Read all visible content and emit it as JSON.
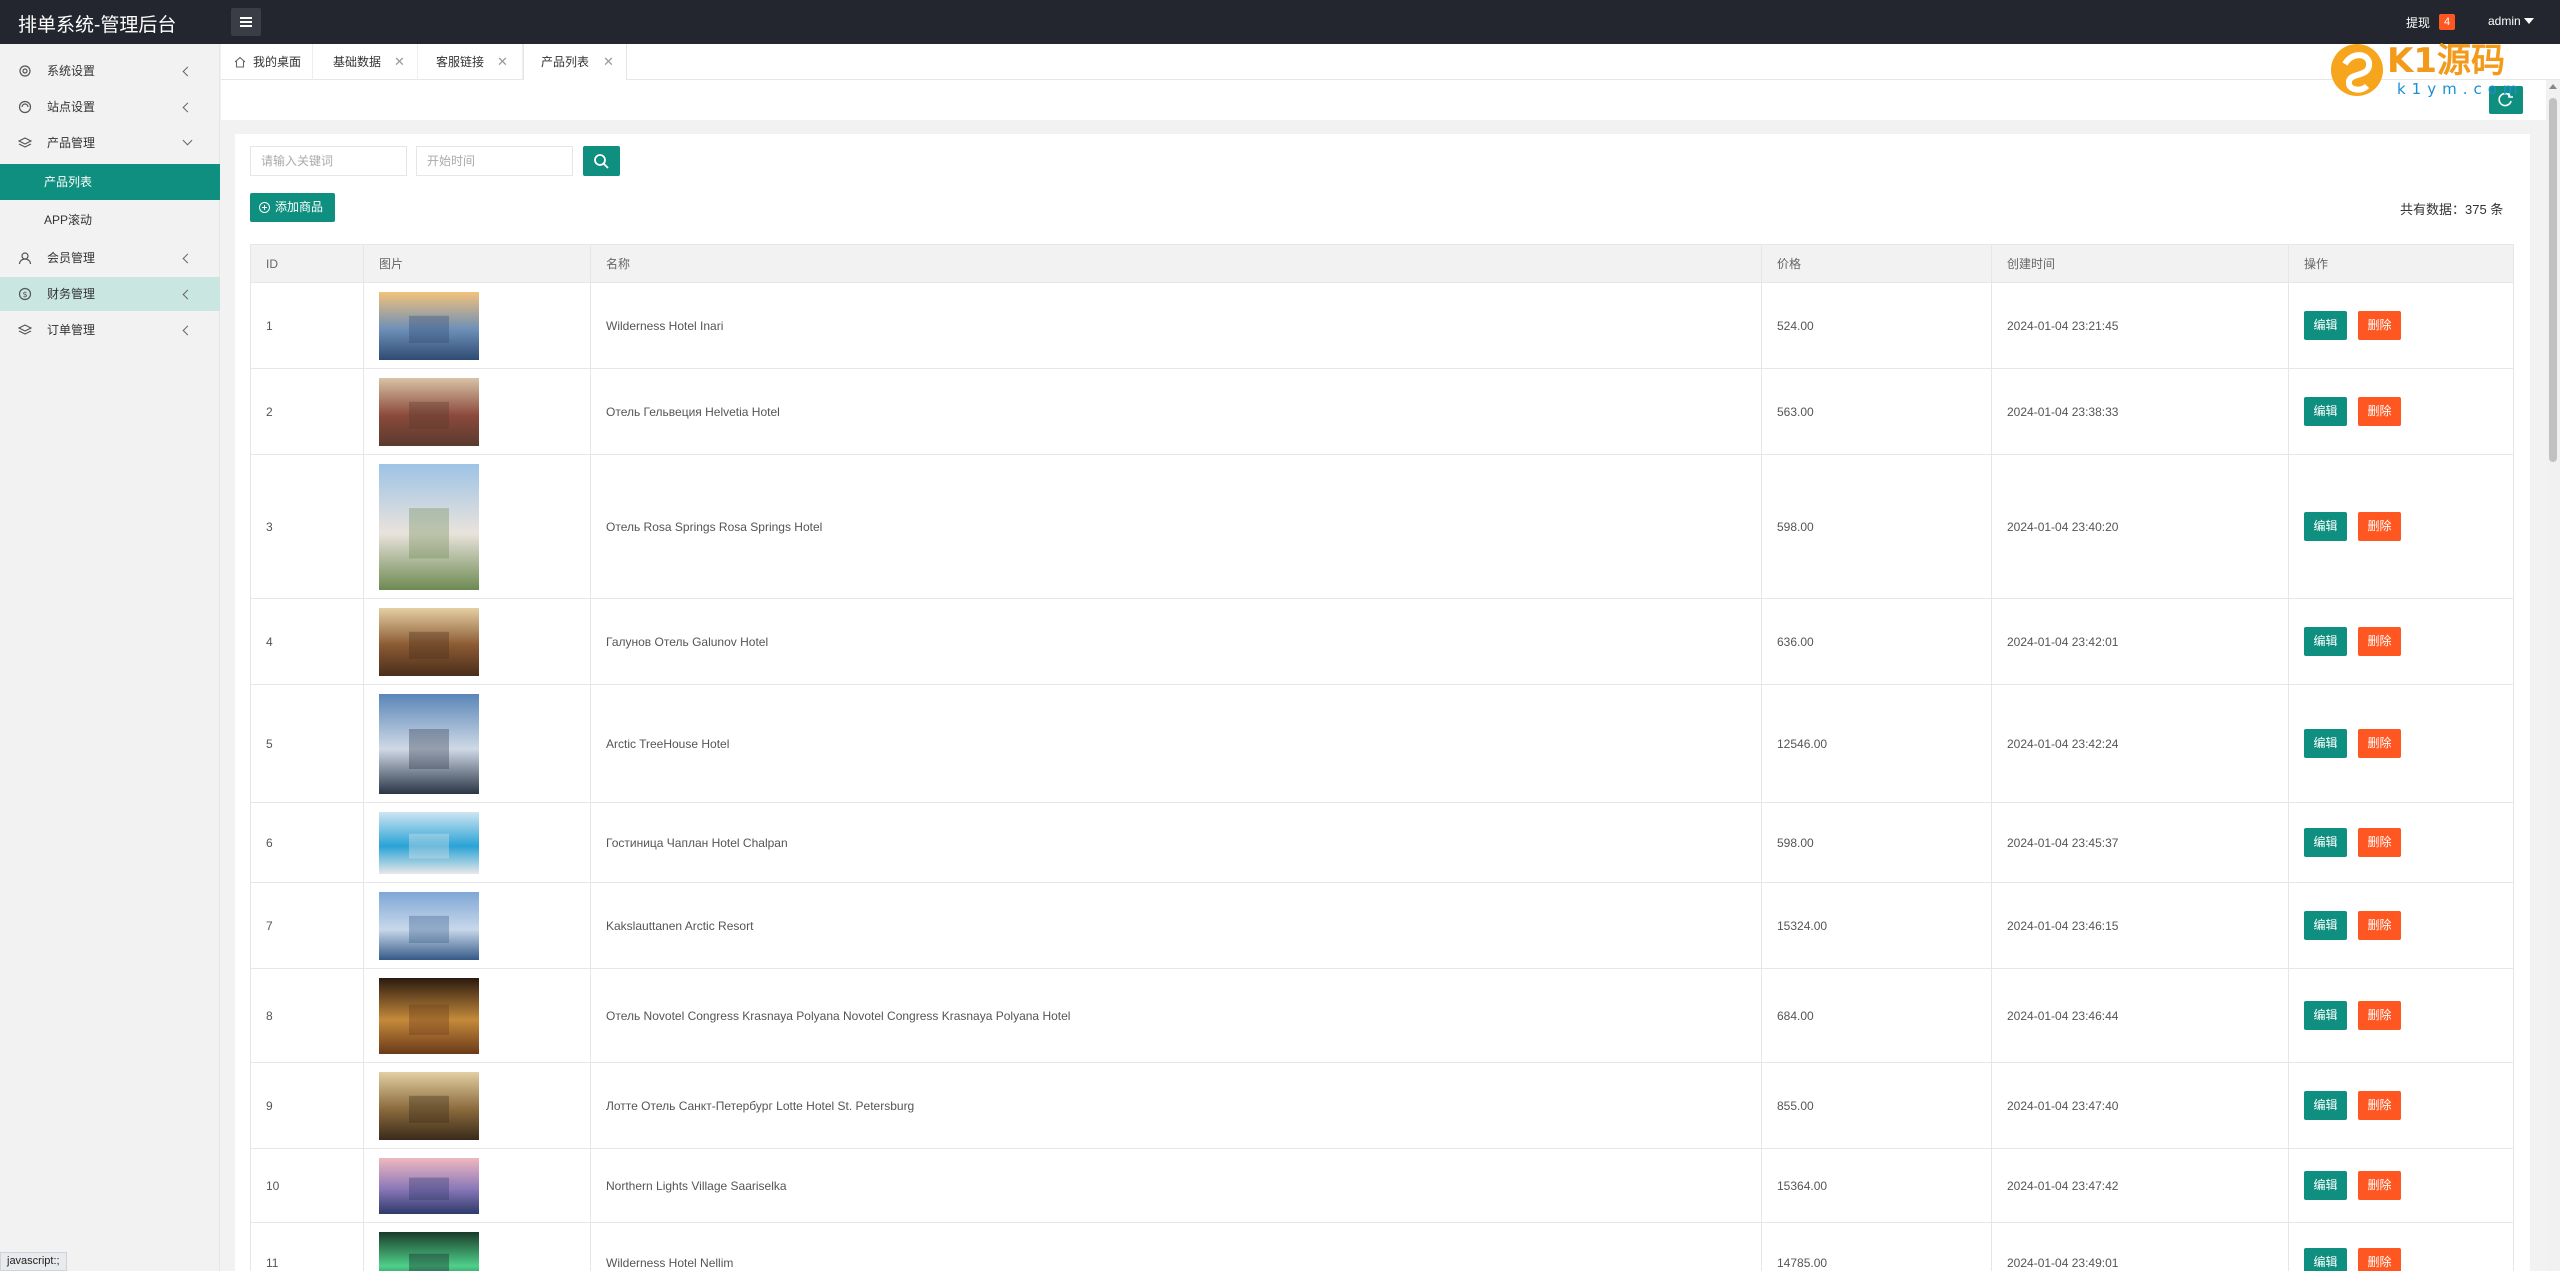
{
  "header": {
    "brand": "排单系统-管理后台",
    "withdraw_label": "提现",
    "withdraw_count": "4",
    "user": "admin"
  },
  "logo": {
    "text_main": "K1源码",
    "text_sub": "k1ym.com"
  },
  "sidebar": {
    "items": [
      {
        "label": "系统设置",
        "icon": "gear-icon"
      },
      {
        "label": "站点设置",
        "icon": "site-icon"
      },
      {
        "label": "产品管理",
        "icon": "product-icon"
      },
      {
        "label": "产品列表"
      },
      {
        "label": "APP滚动"
      },
      {
        "label": "会员管理",
        "icon": "user-icon"
      },
      {
        "label": "财务管理",
        "icon": "finance-icon"
      },
      {
        "label": "订单管理",
        "icon": "order-icon"
      }
    ]
  },
  "tabs": [
    {
      "label": "我的桌面"
    },
    {
      "label": "基础数据"
    },
    {
      "label": "客服链接"
    },
    {
      "label": "产品列表"
    }
  ],
  "search": {
    "keyword_placeholder": "请输入关键词",
    "date_placeholder": "开始时间"
  },
  "toolbar": {
    "add_label": "添加商品",
    "total_text": "共有数据：375 条"
  },
  "table": {
    "headers": [
      "ID",
      "图片",
      "名称",
      "价格",
      "创建时间",
      "操作"
    ],
    "edit_label": "编辑",
    "delete_label": "删除",
    "rows": [
      {
        "id": "1",
        "name": "Wilderness Hotel Inari",
        "price": "524.00",
        "created": "2024-01-04 23:21:45",
        "scene": "snow-sunset"
      },
      {
        "id": "2",
        "name": "Отель Гельвеция Helvetia Hotel",
        "price": "563.00",
        "created": "2024-01-04 23:38:33",
        "scene": "bedroom"
      },
      {
        "id": "3",
        "name": "Отель Rosa Springs Rosa Springs Hotel",
        "price": "598.00",
        "created": "2024-01-04 23:40:20",
        "scene": "building"
      },
      {
        "id": "4",
        "name": "Галунов Отель Galunov Hotel",
        "price": "636.00",
        "created": "2024-01-04 23:42:01",
        "scene": "corridor"
      },
      {
        "id": "5",
        "name": "Arctic TreeHouse Hotel",
        "price": "12546.00",
        "created": "2024-01-04 23:42:24",
        "scene": "snow-cabin"
      },
      {
        "id": "6",
        "name": "Гостиница Чаплан Hotel Chalpan",
        "price": "598.00",
        "created": "2024-01-04 23:45:37",
        "scene": "pool"
      },
      {
        "id": "7",
        "name": "Kakslauttanen Arctic Resort",
        "price": "15324.00",
        "created": "2024-01-04 23:46:15",
        "scene": "snow-igloo"
      },
      {
        "id": "8",
        "name": "Отель Novotel Congress Krasnaya Polyana Novotel Congress Krasnaya Polyana Hotel",
        "price": "684.00",
        "created": "2024-01-04 23:46:44",
        "scene": "hall"
      },
      {
        "id": "9",
        "name": "Лотте Отель Санкт-Петербург Lotte Hotel St. Petersburg",
        "price": "855.00",
        "created": "2024-01-04 23:47:40",
        "scene": "lobby"
      },
      {
        "id": "10",
        "name": "Northern Lights Village Saariselka",
        "price": "15364.00",
        "created": "2024-01-04 23:47:42",
        "scene": "dusk"
      },
      {
        "id": "11",
        "name": "Wilderness Hotel Nellim",
        "price": "14785.00",
        "created": "2024-01-04 23:49:01",
        "scene": "aurora"
      }
    ]
  },
  "statusbar": {
    "url": "javascript:;"
  }
}
